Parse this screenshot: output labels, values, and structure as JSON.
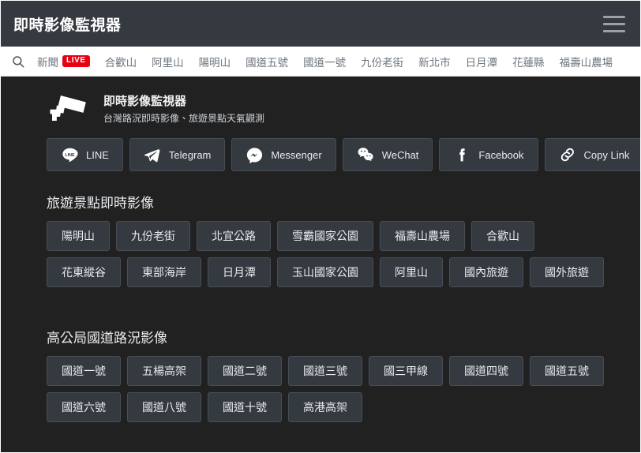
{
  "header": {
    "title": "即時影像監視器",
    "menu_icon": "hamburger-icon"
  },
  "navbar": {
    "search_icon": "search-icon",
    "items": [
      {
        "label": "新聞",
        "badge": "LIVE"
      },
      {
        "label": "合歡山"
      },
      {
        "label": "阿里山"
      },
      {
        "label": "陽明山"
      },
      {
        "label": "國道五號"
      },
      {
        "label": "國道一號"
      },
      {
        "label": "九份老街"
      },
      {
        "label": "新北市"
      },
      {
        "label": "日月潭"
      },
      {
        "label": "花蓮縣"
      },
      {
        "label": "福壽山農場"
      }
    ]
  },
  "brand": {
    "icon": "cctv-camera-icon",
    "title": "即時影像監視器",
    "subtitle": "台灣路況即時影像、旅遊景點天氣觀測"
  },
  "share": {
    "buttons": [
      {
        "label": "LINE",
        "icon": "line-icon"
      },
      {
        "label": "Telegram",
        "icon": "telegram-icon"
      },
      {
        "label": "Messenger",
        "icon": "messenger-icon"
      },
      {
        "label": "WeChat",
        "icon": "wechat-icon"
      },
      {
        "label": "Facebook",
        "icon": "facebook-icon"
      },
      {
        "label": "Copy Link",
        "icon": "link-icon"
      }
    ]
  },
  "sections": [
    {
      "title": "旅遊景點即時影像",
      "chips": [
        "陽明山",
        "九份老街",
        "北宜公路",
        "雪霸國家公園",
        "福壽山農場",
        "合歡山",
        "花東縱谷",
        "東部海岸",
        "日月潭",
        "玉山國家公園",
        "阿里山",
        "國內旅遊",
        "國外旅遊"
      ]
    },
    {
      "title": "高公局國道路況影像",
      "chips": [
        "國道一號",
        "五楊高架",
        "國道二號",
        "國道三號",
        "國三甲線",
        "國道四號",
        "國道五號",
        "國道六號",
        "國道八號",
        "國道十號",
        "高港高架"
      ]
    }
  ],
  "colors": {
    "page_bg": "#212121",
    "header_bg": "#343a40",
    "navbar_bg": "#ffffff",
    "chip_bg": "#343a40",
    "live_badge": "#e60012",
    "text_light": "#e9ecef",
    "nav_text": "#6c757d"
  }
}
